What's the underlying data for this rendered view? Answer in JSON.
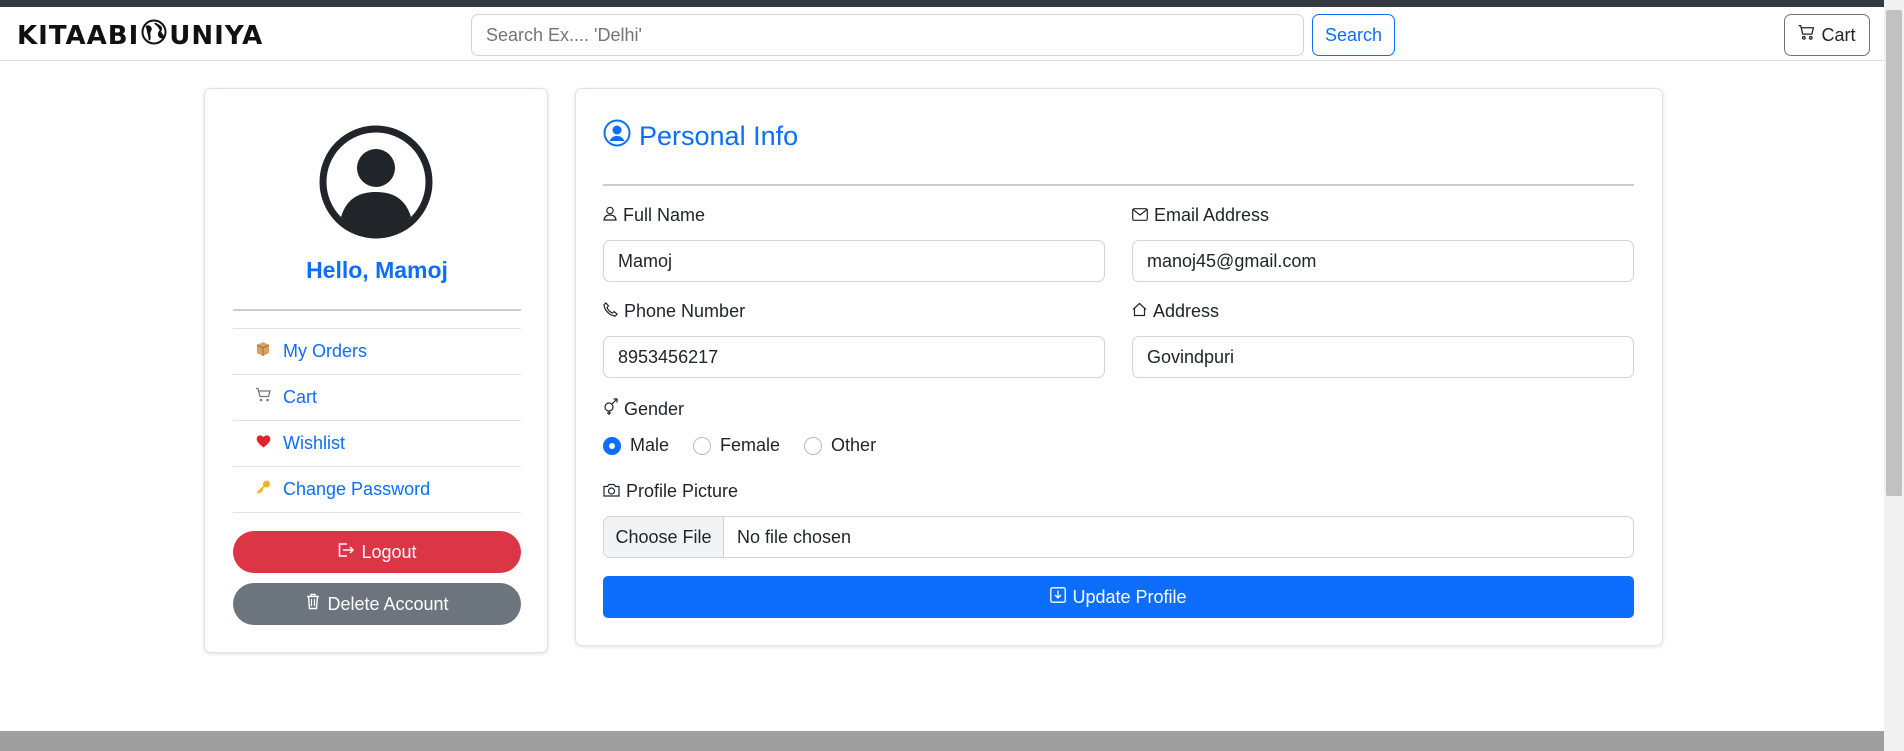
{
  "header": {
    "logo_text_left": "KITAABI",
    "logo_text_right": "UNIYA",
    "search_placeholder": "Search Ex.... 'Delhi'",
    "search_button": "Search",
    "cart_button": "Cart"
  },
  "sidebar": {
    "greeting": "Hello, Mamoj",
    "items": [
      {
        "label": "My Orders",
        "icon": "package-icon"
      },
      {
        "label": "Cart",
        "icon": "shopping-cart-icon"
      },
      {
        "label": "Wishlist",
        "icon": "heart-icon"
      },
      {
        "label": "Change Password",
        "icon": "key-icon"
      }
    ],
    "logout_label": "Logout",
    "delete_label": "Delete Account"
  },
  "profile": {
    "title": "Personal Info",
    "full_name_label": "Full Name",
    "full_name_value": "Mamoj",
    "email_label": "Email Address",
    "email_value": "manoj45@gmail.com",
    "phone_label": "Phone Number",
    "phone_value": "8953456217",
    "address_label": "Address",
    "address_value": "Govindpuri",
    "gender_label": "Gender",
    "gender_options": [
      "Male",
      "Female",
      "Other"
    ],
    "gender_selected": "Male",
    "picture_label": "Profile Picture",
    "choose_file_label": "Choose File",
    "no_file_text": "No file chosen",
    "update_label": "Update Profile"
  },
  "colors": {
    "primary": "#0d6efd",
    "danger": "#dc3545",
    "secondary": "#6c757d"
  }
}
